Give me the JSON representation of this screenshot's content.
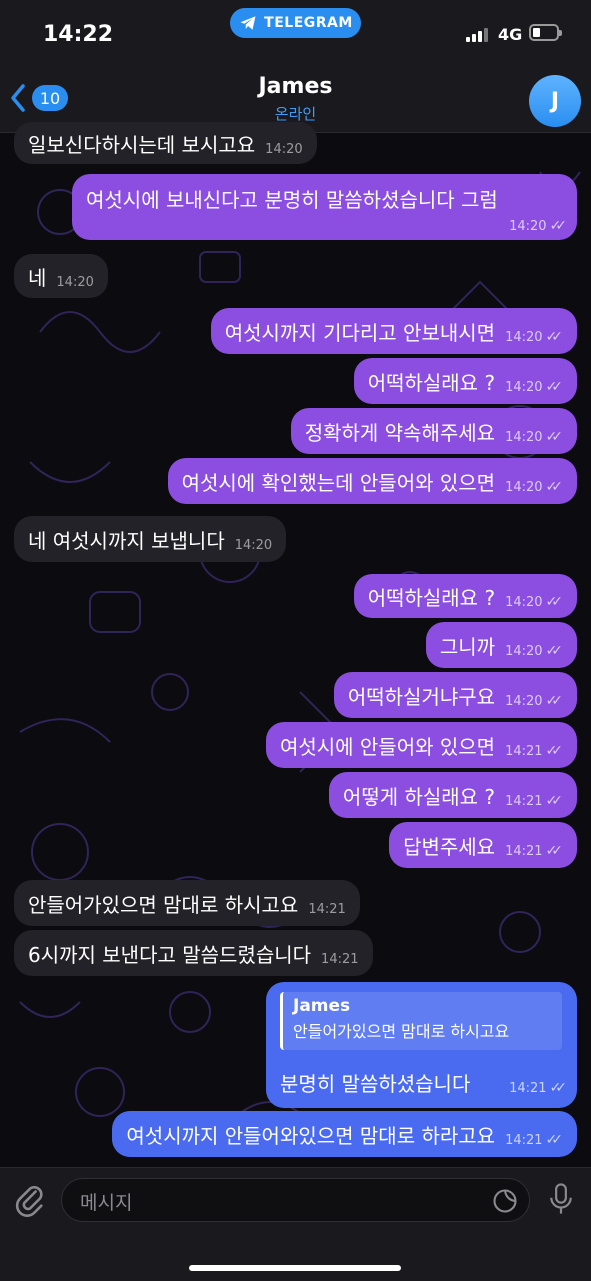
{
  "status_bar": {
    "time": "14:22",
    "app_pill": "TELEGRAM",
    "network": "4G"
  },
  "header": {
    "back_count": "10",
    "title": "James",
    "subtitle": "온라인",
    "avatar_letter": "J"
  },
  "messages": [
    {
      "dir": "in",
      "text": "일보신다하시는데 보시고요",
      "time": "14:20"
    },
    {
      "dir": "out",
      "text": "여섯시에 보내신다고 분명히 말씀하셨습니다 그럼",
      "time": "14:20"
    },
    {
      "dir": "in",
      "text": "네",
      "time": "14:20"
    },
    {
      "dir": "out",
      "text": "여섯시까지 기다리고 안보내시면",
      "time": "14:20"
    },
    {
      "dir": "out",
      "text": "어떡하실래요 ?",
      "time": "14:20"
    },
    {
      "dir": "out",
      "text": "정확하게 약속해주세요",
      "time": "14:20"
    },
    {
      "dir": "out",
      "text": "여섯시에 확인했는데 안들어와 있으면",
      "time": "14:20"
    },
    {
      "dir": "in",
      "text": "네 여섯시까지 보냅니다",
      "time": "14:20"
    },
    {
      "dir": "out",
      "text": "어떡하실래요 ?",
      "time": "14:20"
    },
    {
      "dir": "out",
      "text": "그니까",
      "time": "14:20"
    },
    {
      "dir": "out",
      "text": "어떡하실거냐구요",
      "time": "14:20"
    },
    {
      "dir": "out",
      "text": "여섯시에 안들어와 있으면",
      "time": "14:21"
    },
    {
      "dir": "out",
      "text": "어떻게 하실래요 ?",
      "time": "14:21"
    },
    {
      "dir": "out",
      "text": "답변주세요",
      "time": "14:21"
    },
    {
      "dir": "in",
      "text": "안들어가있으면 맘대로 하시고요",
      "time": "14:21"
    },
    {
      "dir": "in",
      "text": "6시까지 보낸다고 말씀드렸습니다",
      "time": "14:21"
    }
  ],
  "reply_message": {
    "quote_name": "James",
    "quote_text": "안들어가있으면 맘대로 하시고요",
    "text": "분명히 말씀하셨습니다",
    "time": "14:21"
  },
  "last_message": {
    "text": "여섯시까지 안들어와있으면 맘대로 하라고요",
    "time": "14:21"
  },
  "input": {
    "placeholder": "메시지"
  },
  "colors": {
    "outgoing": "#8b4ee0",
    "outgoing_blue": "#4a6bf0",
    "incoming": "#232228",
    "accent": "#2a8ef0"
  }
}
